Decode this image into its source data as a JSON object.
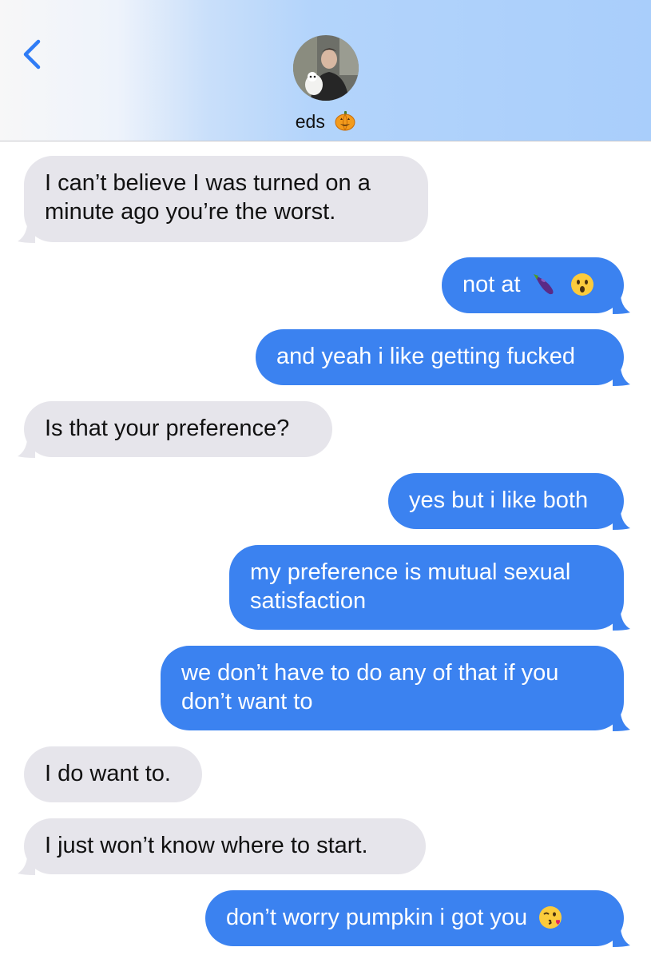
{
  "header": {
    "contact_name": "eds",
    "name_icon": "pumpkin-icon",
    "back_icon": "chevron-left-icon",
    "gradient_colors": [
      "#f7f7f8",
      "#a9cefb"
    ]
  },
  "colors": {
    "incoming_bubble": "#e6e5eb",
    "outgoing_bubble": "#3b82f0",
    "back_chevron": "#2f7cf6"
  },
  "messages": [
    {
      "direction": "incoming",
      "text": "I can’t believe I was turned on a minute ago you’re the worst."
    },
    {
      "direction": "outgoing",
      "text": "not at",
      "emojis": [
        "eggplant-icon",
        "surprised-face-icon"
      ]
    },
    {
      "direction": "outgoing",
      "text": "and yeah i like getting fucked"
    },
    {
      "direction": "incoming",
      "text": "Is that your preference?"
    },
    {
      "direction": "outgoing",
      "text": "yes but i like both"
    },
    {
      "direction": "outgoing",
      "text": "my preference is mutual sexual satisfaction"
    },
    {
      "direction": "outgoing",
      "text": "we don’t have to do any of that if you don’t want to"
    },
    {
      "direction": "incoming",
      "text": "I do want to."
    },
    {
      "direction": "incoming",
      "text": "I just won’t know where to start."
    },
    {
      "direction": "outgoing",
      "text": "don’t worry pumpkin i got you",
      "emojis": [
        "kissing-face-icon"
      ]
    }
  ]
}
